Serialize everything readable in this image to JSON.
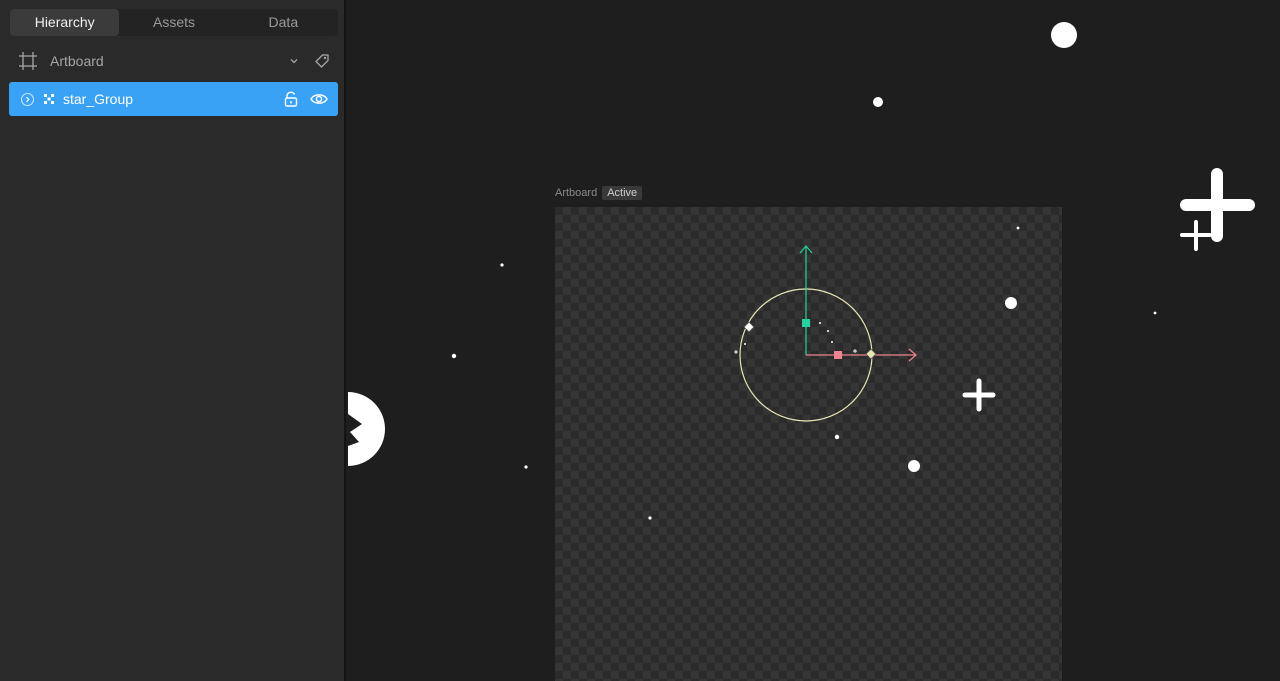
{
  "panel": {
    "tabs": [
      {
        "label": "Hierarchy",
        "active": true
      },
      {
        "label": "Assets",
        "active": false
      },
      {
        "label": "Data",
        "active": false
      }
    ],
    "artboard": {
      "label": "Artboard"
    },
    "layer": {
      "label": "star_Group",
      "selected": true
    }
  },
  "canvas": {
    "artboard_label": "Artboard",
    "artboard_badge": "Active"
  },
  "colors": {
    "selection": "#3aa2f5",
    "y_axis": "#26d3a0",
    "x_axis": "#f0848e",
    "rotation_ring": "#e9e6b2",
    "canvas_bg": "#1e1e1e",
    "panel_bg": "#2a2a2a"
  }
}
